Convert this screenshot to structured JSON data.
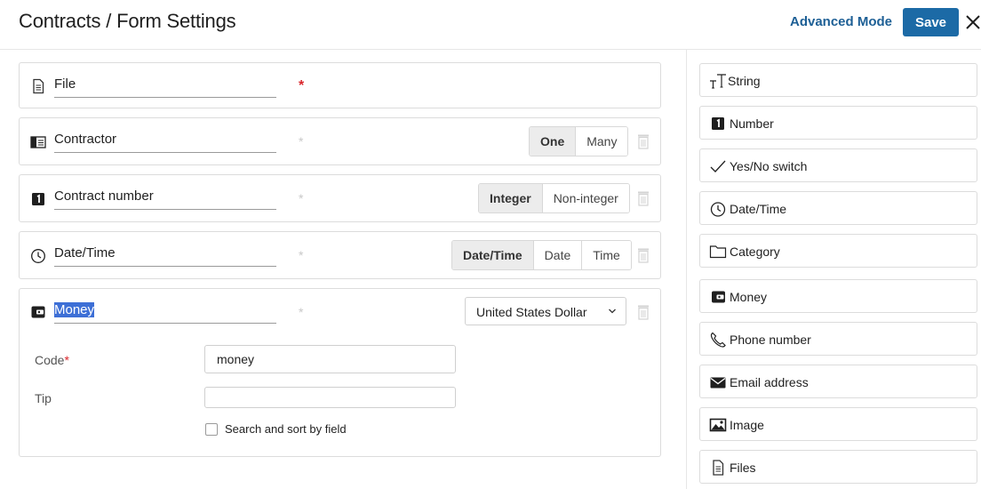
{
  "header": {
    "breadcrumb_title": "Contracts / Form Settings",
    "advanced_mode_label": "Advanced Mode",
    "save_label": "Save"
  },
  "fields": [
    {
      "name": "File",
      "icon": "file-icon",
      "required": true
    },
    {
      "name": "Contractor",
      "icon": "contractor-card-icon",
      "required": false,
      "options": [
        "One",
        "Many"
      ],
      "selected": "One"
    },
    {
      "name": "Contract number",
      "icon": "number-icon",
      "required": false,
      "options": [
        "Integer",
        "Non-integer"
      ],
      "selected": "Integer"
    },
    {
      "name": "Date/Time",
      "icon": "clock-icon",
      "required": false,
      "options": [
        "Date/Time",
        "Date",
        "Time"
      ],
      "selected": "Date/Time"
    },
    {
      "name": "Money",
      "icon": "wallet-icon",
      "required": false,
      "currency": "United States Dollar",
      "code_label": "Code",
      "code_required_mark": "*",
      "code_value": "money",
      "tip_label": "Tip",
      "tip_value": "",
      "search_sort_label": "Search and sort by field",
      "search_sort_checked": false
    }
  ],
  "required_mark": "*",
  "palette": [
    {
      "label": "String",
      "icon": "text-type-icon"
    },
    {
      "label": "Number",
      "icon": "number-icon"
    },
    {
      "label": "Yes/No switch",
      "icon": "checkmark-icon"
    },
    {
      "label": "Date/Time",
      "icon": "clock-icon"
    },
    {
      "label": "Category",
      "icon": "folder-icon"
    },
    {
      "label": "Money",
      "icon": "wallet-icon"
    },
    {
      "label": "Phone number",
      "icon": "phone-icon"
    },
    {
      "label": "Email address",
      "icon": "envelope-icon"
    },
    {
      "label": "Image",
      "icon": "image-icon"
    },
    {
      "label": "Files",
      "icon": "file-icon"
    }
  ],
  "colors": {
    "accent": "#1c6aa6",
    "link": "#1d5f95",
    "required": "#d9262b",
    "selection": "#3d6fd6"
  }
}
